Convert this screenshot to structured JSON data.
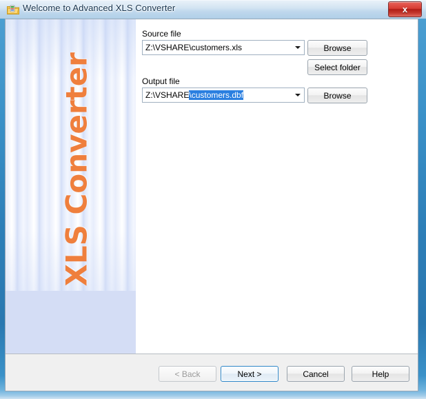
{
  "window": {
    "title": "Welcome to Advanced XLS Converter",
    "icon": "folder-xls-icon",
    "close_label": "x"
  },
  "banner": {
    "product_name": "XLS Converter",
    "accent_color": "#ef7f3d"
  },
  "form": {
    "source": {
      "label": "Source file",
      "value": "Z:\\VSHARE\\customers.xls",
      "browse_label": "Browse",
      "select_folder_label": "Select folder"
    },
    "output": {
      "label": "Output file",
      "value_prefix": "Z:\\VSHARE",
      "value_selected": "\\customers.dbf",
      "browse_label": "Browse",
      "selection_color": "#2a7fe0"
    }
  },
  "footer": {
    "back_label": "< Back",
    "next_label": "Next >",
    "cancel_label": "Cancel",
    "help_label": "Help"
  }
}
